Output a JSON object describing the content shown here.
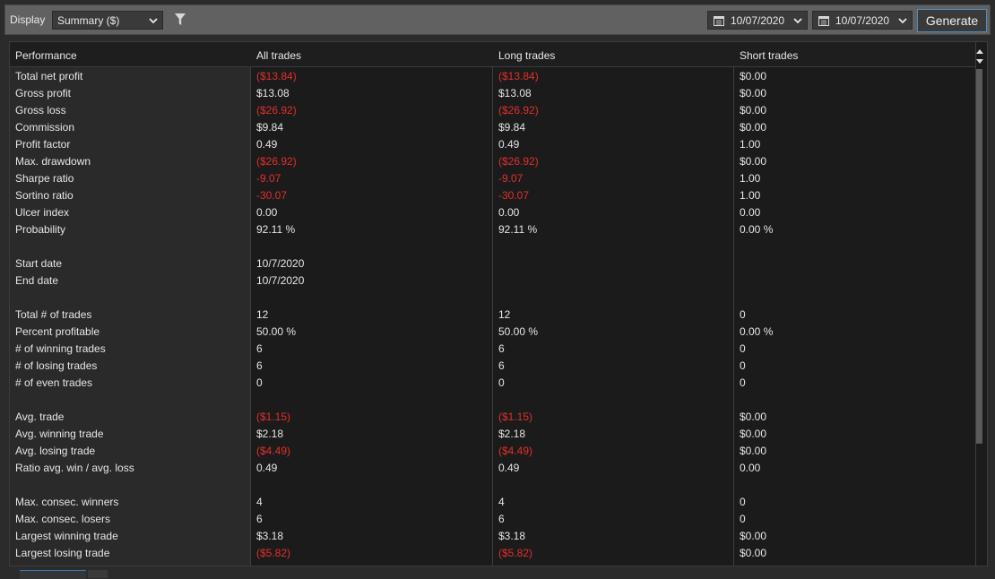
{
  "toolbar": {
    "display_label": "Display",
    "display_value": "Summary ($)",
    "from_date": "10/07/2020",
    "to_date": "10/07/2020",
    "generate_label": "Generate"
  },
  "columns": [
    "Performance",
    "All trades",
    "Long trades",
    "Short trades"
  ],
  "colors": {
    "negative": "#e0302a",
    "accent": "#4d8ec7"
  },
  "rows": [
    {
      "label": "Total net profit",
      "all": "($13.84)",
      "long": "($13.84)",
      "short": "$0.00",
      "neg": [
        true,
        true,
        false
      ]
    },
    {
      "label": "Gross profit",
      "all": "$13.08",
      "long": "$13.08",
      "short": "$0.00",
      "neg": [
        false,
        false,
        false
      ]
    },
    {
      "label": "Gross loss",
      "all": "($26.92)",
      "long": "($26.92)",
      "short": "$0.00",
      "neg": [
        true,
        true,
        false
      ]
    },
    {
      "label": "Commission",
      "all": "$9.84",
      "long": "$9.84",
      "short": "$0.00",
      "neg": [
        false,
        false,
        false
      ]
    },
    {
      "label": "Profit factor",
      "all": "0.49",
      "long": "0.49",
      "short": "1.00",
      "neg": [
        false,
        false,
        false
      ]
    },
    {
      "label": "Max. drawdown",
      "all": "($26.92)",
      "long": "($26.92)",
      "short": "$0.00",
      "neg": [
        true,
        true,
        false
      ]
    },
    {
      "label": "Sharpe ratio",
      "all": "-9.07",
      "long": "-9.07",
      "short": "1.00",
      "neg": [
        true,
        true,
        false
      ]
    },
    {
      "label": "Sortino ratio",
      "all": "-30.07",
      "long": "-30.07",
      "short": "1.00",
      "neg": [
        true,
        true,
        false
      ]
    },
    {
      "label": "Ulcer index",
      "all": "0.00",
      "long": "0.00",
      "short": "0.00",
      "neg": [
        false,
        false,
        false
      ]
    },
    {
      "label": "Probability",
      "all": "92.11 %",
      "long": "92.11 %",
      "short": "0.00 %",
      "neg": [
        false,
        false,
        false
      ]
    },
    {
      "label": "",
      "all": "",
      "long": "",
      "short": "",
      "neg": [
        false,
        false,
        false
      ]
    },
    {
      "label": "Start date",
      "all": "10/7/2020",
      "long": "",
      "short": "",
      "neg": [
        false,
        false,
        false
      ]
    },
    {
      "label": "End date",
      "all": "10/7/2020",
      "long": "",
      "short": "",
      "neg": [
        false,
        false,
        false
      ]
    },
    {
      "label": "",
      "all": "",
      "long": "",
      "short": "",
      "neg": [
        false,
        false,
        false
      ]
    },
    {
      "label": "Total # of trades",
      "all": "12",
      "long": "12",
      "short": "0",
      "neg": [
        false,
        false,
        false
      ]
    },
    {
      "label": "Percent profitable",
      "all": "50.00 %",
      "long": "50.00 %",
      "short": "0.00 %",
      "neg": [
        false,
        false,
        false
      ]
    },
    {
      "label": "# of winning trades",
      "all": "6",
      "long": "6",
      "short": "0",
      "neg": [
        false,
        false,
        false
      ]
    },
    {
      "label": "# of losing trades",
      "all": "6",
      "long": "6",
      "short": "0",
      "neg": [
        false,
        false,
        false
      ]
    },
    {
      "label": "# of even trades",
      "all": "0",
      "long": "0",
      "short": "0",
      "neg": [
        false,
        false,
        false
      ]
    },
    {
      "label": "",
      "all": "",
      "long": "",
      "short": "",
      "neg": [
        false,
        false,
        false
      ]
    },
    {
      "label": "Avg. trade",
      "all": "($1.15)",
      "long": "($1.15)",
      "short": "$0.00",
      "neg": [
        true,
        true,
        false
      ]
    },
    {
      "label": "Avg. winning trade",
      "all": "$2.18",
      "long": "$2.18",
      "short": "$0.00",
      "neg": [
        false,
        false,
        false
      ]
    },
    {
      "label": "Avg. losing trade",
      "all": "($4.49)",
      "long": "($4.49)",
      "short": "$0.00",
      "neg": [
        true,
        true,
        false
      ]
    },
    {
      "label": "Ratio avg. win / avg. loss",
      "all": "0.49",
      "long": "0.49",
      "short": "0.00",
      "neg": [
        false,
        false,
        false
      ]
    },
    {
      "label": "",
      "all": "",
      "long": "",
      "short": "",
      "neg": [
        false,
        false,
        false
      ]
    },
    {
      "label": "Max. consec. winners",
      "all": "4",
      "long": "4",
      "short": "0",
      "neg": [
        false,
        false,
        false
      ]
    },
    {
      "label": "Max. consec. losers",
      "all": "6",
      "long": "6",
      "short": "0",
      "neg": [
        false,
        false,
        false
      ]
    },
    {
      "label": "Largest winning trade",
      "all": "$3.18",
      "long": "$3.18",
      "short": "$0.00",
      "neg": [
        false,
        false,
        false
      ]
    },
    {
      "label": "Largest losing trade",
      "all": "($5.82)",
      "long": "($5.82)",
      "short": "$0.00",
      "neg": [
        true,
        true,
        false
      ]
    }
  ]
}
